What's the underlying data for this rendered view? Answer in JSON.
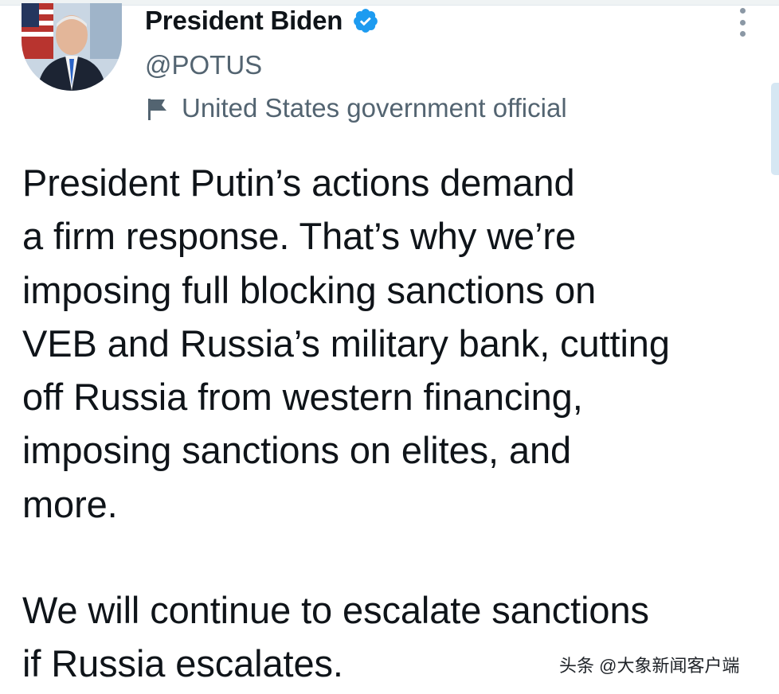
{
  "author": {
    "display_name": "President Biden",
    "handle": "@POTUS",
    "label": "United States government official",
    "verified": true
  },
  "tweet": {
    "paragraph_1": "President Putin’s actions demand\na firm response. That’s why we’re\nimposing full blocking sanctions on\nVEB and Russia’s military bank, cutting\noff Russia from western financing,\nimposing sanctions on elites, and\nmore.",
    "paragraph_2": "We will continue to escalate sanctions\nif Russia escalates."
  },
  "watermark": "头条 @大象新闻客户端",
  "colors": {
    "verified_badge": "#1d9bf0",
    "secondary_text": "#536471",
    "primary_text": "#0f1419",
    "scrollbar": "#d6e7f3"
  },
  "icons": {
    "verified": "verified-badge-icon",
    "government": "flag-icon",
    "more": "more-vertical-icon"
  }
}
